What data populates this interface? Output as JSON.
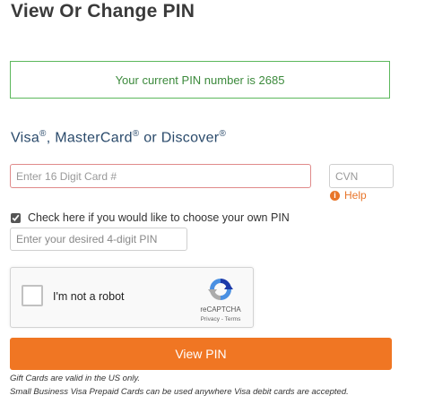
{
  "page": {
    "title": "View Or Change PIN"
  },
  "pin_message": "Your current PIN number is 2685",
  "card_brands": {
    "visa": "Visa",
    "mastercard": "MasterCard",
    "or_text": "or Discover",
    "registered_mark": "®"
  },
  "card_number": {
    "placeholder": "Enter 16 Digit Card #",
    "value": ""
  },
  "cvn": {
    "placeholder": "CVN",
    "value": ""
  },
  "help": {
    "icon_glyph": "i",
    "label": "Help"
  },
  "choose_pin": {
    "label": "Check here if you would like to choose your own PIN",
    "checked": true
  },
  "desired_pin": {
    "placeholder": "Enter your desired 4-digit PIN",
    "value": ""
  },
  "recaptcha": {
    "label": "I'm not a robot",
    "brand": "reCAPTCHA",
    "links": "Privacy - Terms"
  },
  "submit_button": {
    "label": "View PIN"
  },
  "notes": {
    "gift_cards": "Gift Cards are valid in the US only.",
    "business_cards": "Small Business Visa Prepaid Cards can be used anywhere Visa debit cards are accepted."
  },
  "colors": {
    "accent_orange": "#f07623",
    "success_green": "#5cb85c",
    "error_border": "#e08a8a",
    "brand_blue": "#2a4a6b"
  }
}
